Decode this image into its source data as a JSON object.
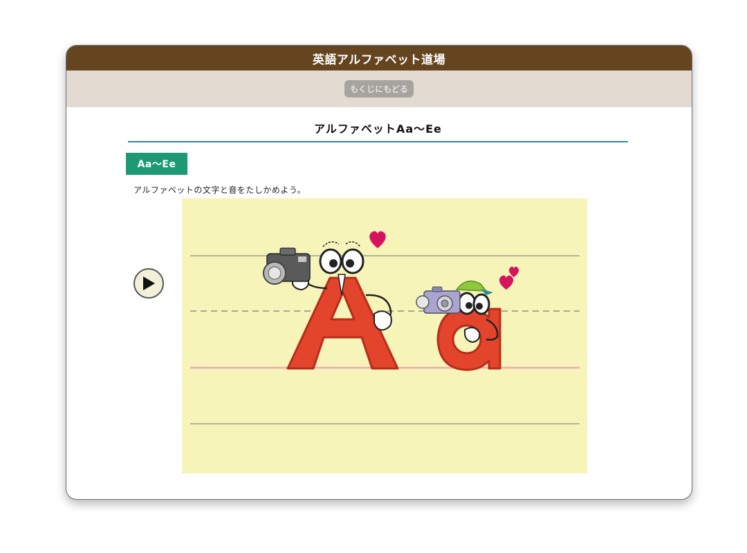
{
  "app": {
    "title": "英語アルファベット道場"
  },
  "nav": {
    "back_label": "もくじにもどる"
  },
  "lesson": {
    "heading": "アルファベットAa～Ee",
    "tag": "Aa～Ee",
    "instruction": "アルファベットの文字と音をたしかめよう。",
    "letter_upper": "A",
    "letter_lower": "a"
  },
  "colors": {
    "titlebar": "#654520",
    "navbar": "#e3dbd2",
    "accent_teal": "#2a8d92",
    "tag_green": "#1e9a73",
    "canvas_yellow": "#f6f4b8",
    "letter_red": "#e2442c",
    "heart_pink": "#d6135f"
  },
  "icons": {
    "play": "play-icon",
    "camera": "camera-icon",
    "heart": "heart-icon"
  }
}
